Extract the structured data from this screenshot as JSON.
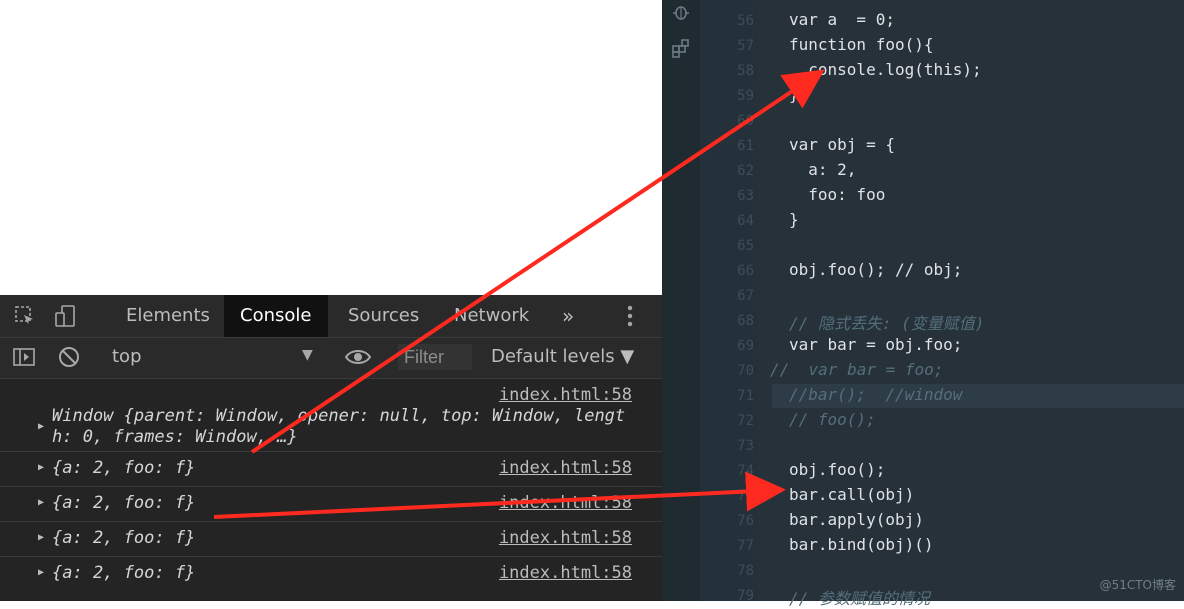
{
  "devtools": {
    "tabs": [
      "Elements",
      "Console",
      "Sources",
      "Network"
    ],
    "active_tab": "Console",
    "more_tabs_label": "»",
    "context_selector": "top",
    "filter_placeholder": "Filter",
    "levels_label": "Default levels ▼",
    "messages": [
      {
        "source": "index.html:58",
        "line1": "Window {parent: Window, opener: null, top: Window, lengt",
        "line2": "h: 0, frames: Window, …}"
      },
      {
        "source": "index.html:58",
        "text": "{a: 2, foo: f}"
      },
      {
        "source": "index.html:58",
        "text": "{a: 2, foo: f}"
      },
      {
        "source": "index.html:58",
        "text": "{a: 2, foo: f}"
      },
      {
        "source": "index.html:58",
        "text": "{a: 2, foo: f}"
      }
    ]
  },
  "editor": {
    "line_numbers": [
      "56",
      "57",
      "58",
      "59",
      "60",
      "61",
      "62",
      "63",
      "64",
      "65",
      "66",
      "67",
      "68",
      "69",
      "70",
      "71",
      "72",
      "73",
      "74",
      "75",
      "76",
      "77",
      "78",
      "79"
    ],
    "lines": [
      "var a  = 0;",
      "function foo(){",
      "  console.log(this);",
      "}",
      "",
      "var obj = {",
      "  a: 2,",
      "  foo: foo",
      "}",
      "",
      "obj.foo(); // obj;",
      "",
      "// 隐式丢失: (变量赋值)",
      "var bar = obj.foo;",
      "//  var bar = foo;",
      "//bar();  //window",
      "// foo();",
      "",
      "obj.foo();",
      "bar.call(obj)",
      "bar.apply(obj)",
      "bar.bind(obj)()",
      "",
      "// 参数赋值的情况"
    ],
    "watermark": "@51CTO博客"
  },
  "colors": {
    "arrow": "#ff2a1f",
    "editor_bg": "#263139",
    "devtools_bg": "#242424"
  }
}
